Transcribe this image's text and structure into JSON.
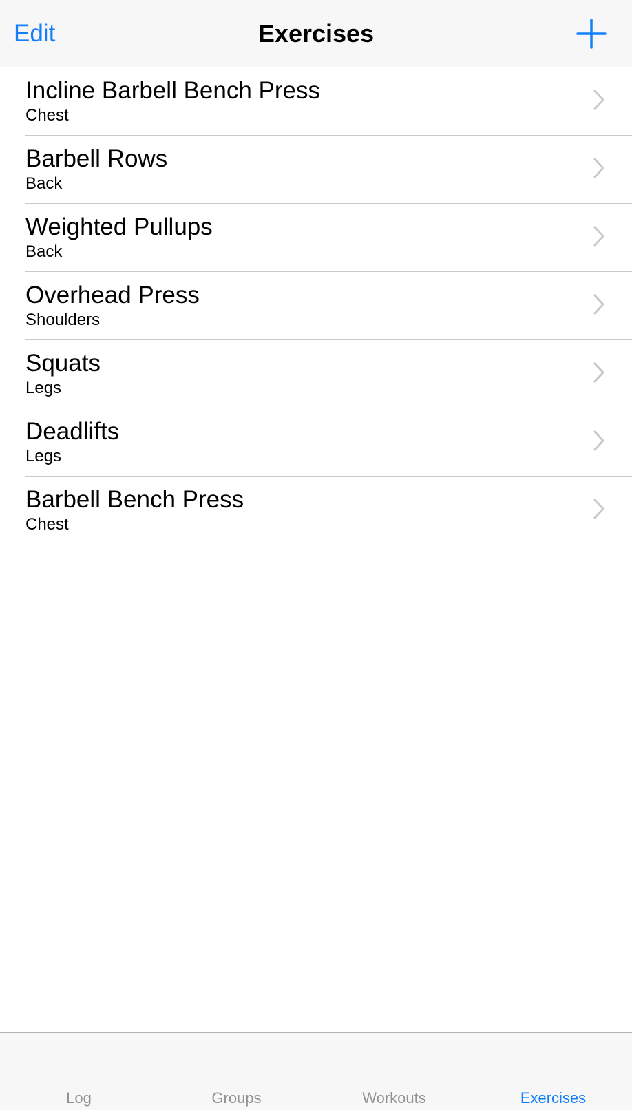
{
  "nav": {
    "edit_label": "Edit",
    "title": "Exercises",
    "add_icon": "plus-icon"
  },
  "exercises": [
    {
      "name": "Incline Barbell Bench Press",
      "muscle": "Chest"
    },
    {
      "name": "Barbell Rows",
      "muscle": "Back"
    },
    {
      "name": "Weighted Pullups",
      "muscle": "Back"
    },
    {
      "name": "Overhead Press",
      "muscle": "Shoulders"
    },
    {
      "name": "Squats",
      "muscle": "Legs"
    },
    {
      "name": "Deadlifts",
      "muscle": "Legs"
    },
    {
      "name": "Barbell Bench Press",
      "muscle": "Chest"
    }
  ],
  "tabs": [
    {
      "label": "Log",
      "active": false
    },
    {
      "label": "Groups",
      "active": false
    },
    {
      "label": "Workouts",
      "active": false
    },
    {
      "label": "Exercises",
      "active": true
    }
  ],
  "colors": {
    "accent": "#157efb",
    "inactive_tab": "#929292",
    "separator": "#c8c7cc",
    "chevron": "#c7c7cc",
    "bar_background": "#f7f7f7"
  }
}
